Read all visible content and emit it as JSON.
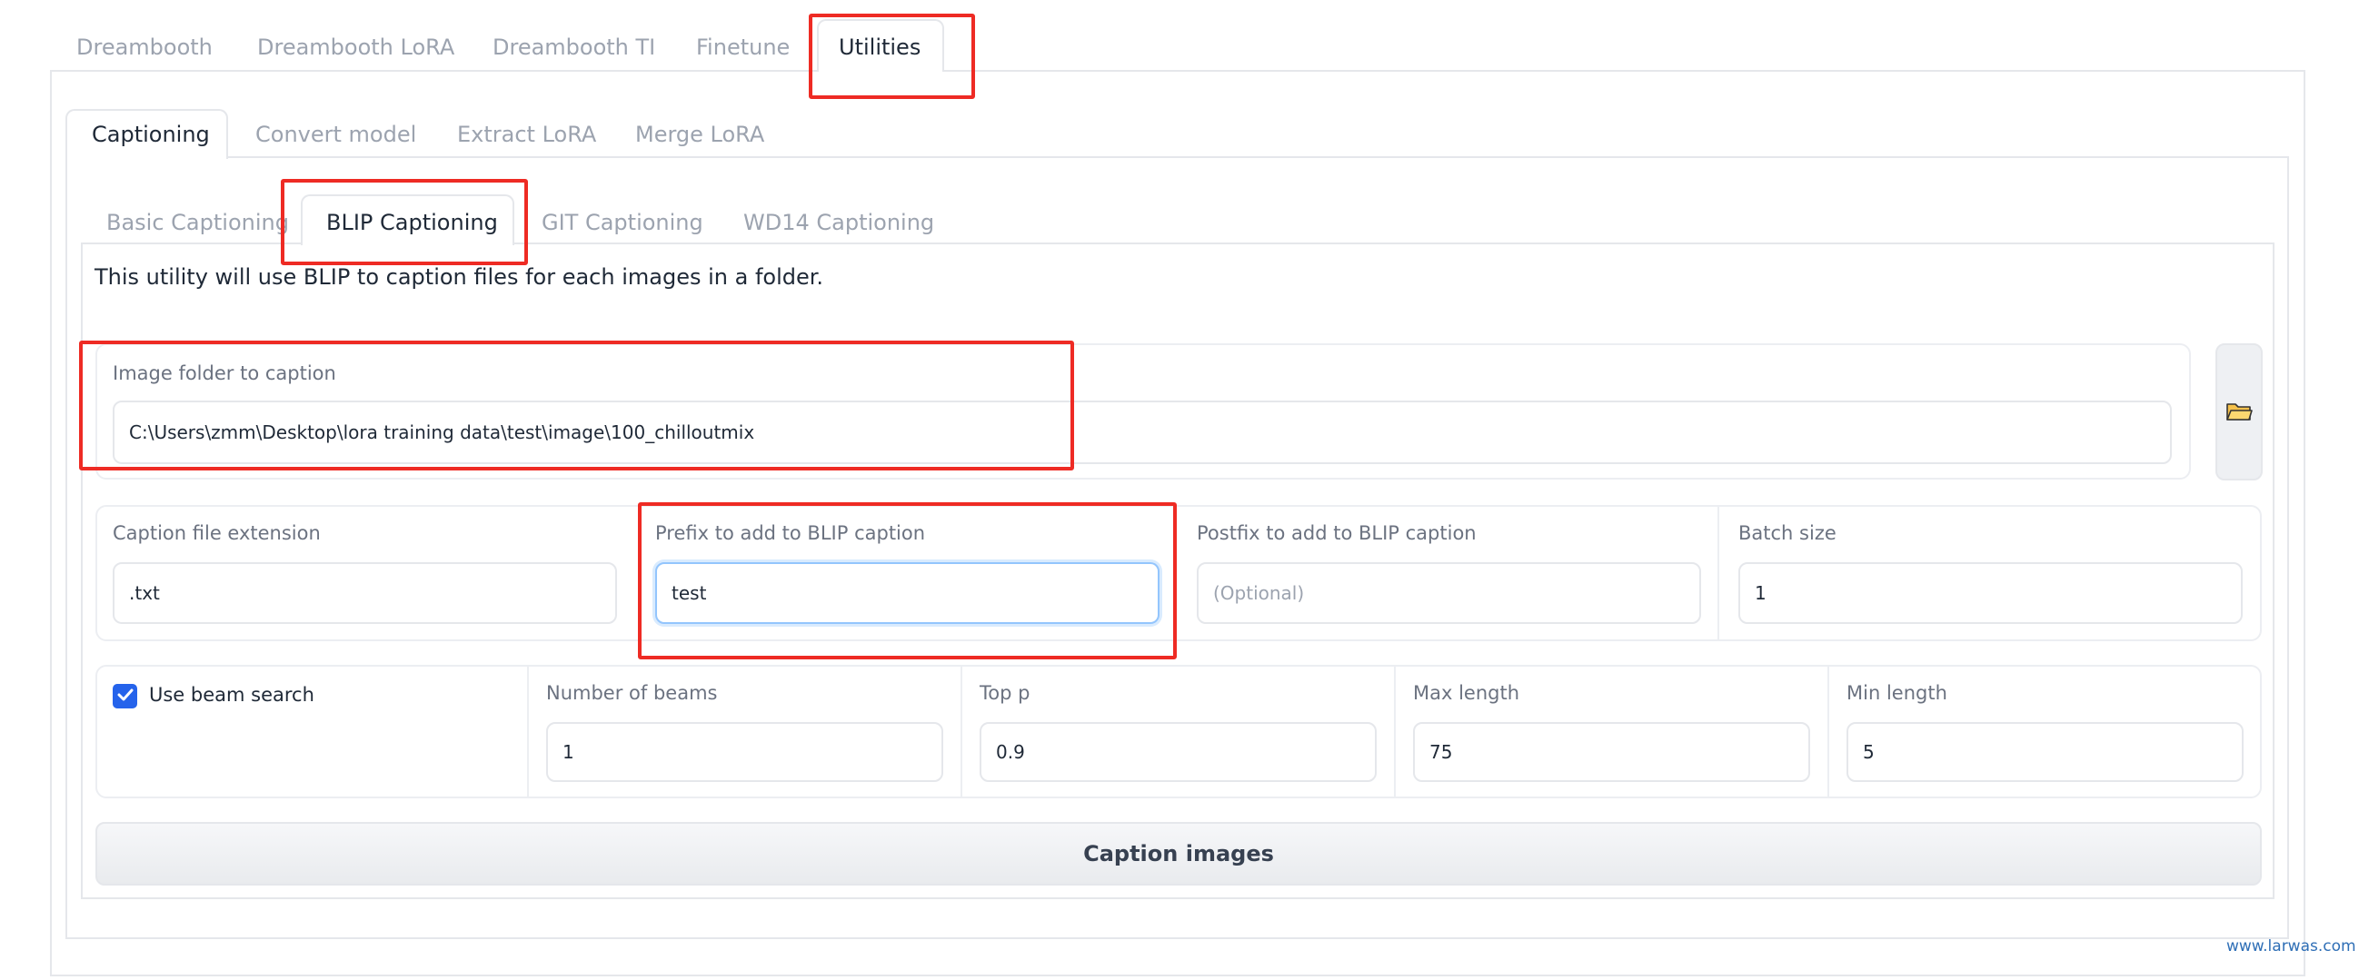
{
  "top_tabs": [
    "Dreambooth",
    "Dreambooth LoRA",
    "Dreambooth TI",
    "Finetune",
    "Utilities"
  ],
  "utility_tabs": [
    "Captioning",
    "Convert model",
    "Extract LoRA",
    "Merge LoRA"
  ],
  "caption_tabs": [
    "Basic Captioning",
    "BLIP Captioning",
    "GIT Captioning",
    "WD14 Captioning"
  ],
  "description": "This utility will use BLIP to caption files for each images in a folder.",
  "image_folder": {
    "label": "Image folder to caption",
    "value": "C:\\Users\\zmm\\Desktop\\lora training data\\test\\image\\100_chilloutmix",
    "folder_icon": "folder-icon"
  },
  "caption_ext": {
    "label": "Caption file extension",
    "value": ".txt"
  },
  "prefix": {
    "label": "Prefix to add to BLIP caption",
    "value": "test"
  },
  "postfix": {
    "label": "Postfix to add to BLIP caption",
    "value": "",
    "placeholder": "(Optional)"
  },
  "batch_size": {
    "label": "Batch size",
    "value": "1"
  },
  "beam_search": {
    "label": "Use beam search",
    "checked": true
  },
  "num_beams": {
    "label": "Number of beams",
    "value": "1"
  },
  "top_p": {
    "label": "Top p",
    "value": "0.9"
  },
  "max_length": {
    "label": "Max length",
    "value": "75"
  },
  "min_length": {
    "label": "Min length",
    "value": "5"
  },
  "caption_button": "Caption images",
  "watermark": "www.larwas.com",
  "colors": {
    "highlight": "#ee2b24",
    "checkbox": "#2563eb",
    "focus": "#93c5fd"
  }
}
